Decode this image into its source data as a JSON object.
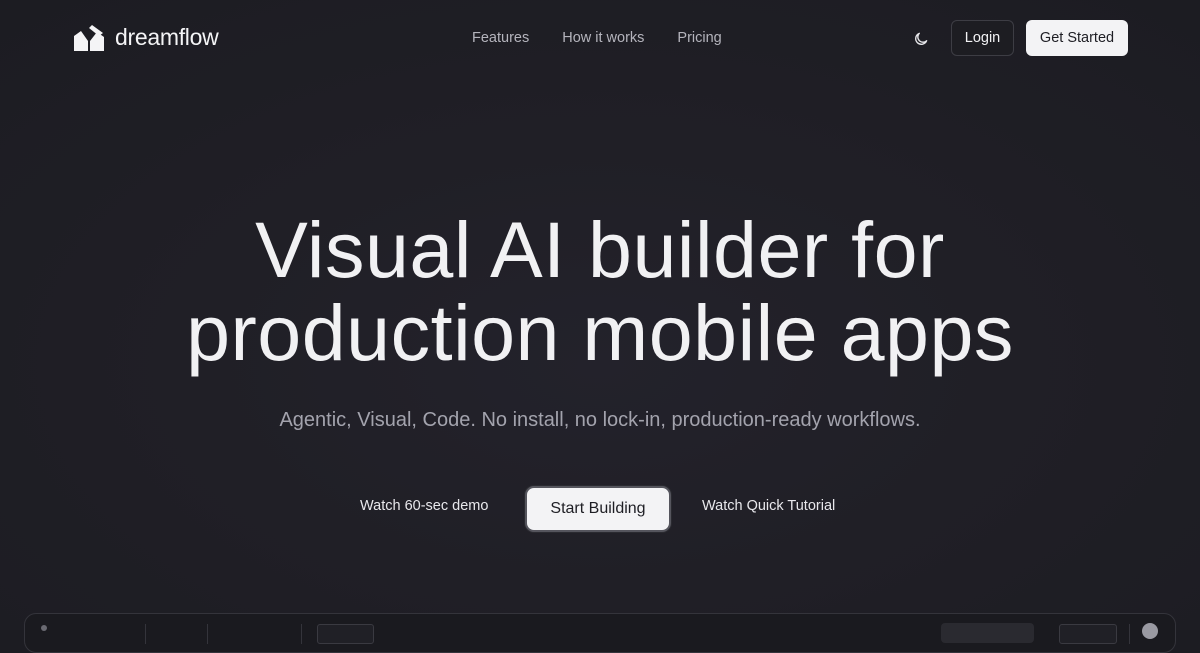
{
  "brand": {
    "name": "dreamflow",
    "logo_icon": "dreamflow-logo-icon"
  },
  "nav": {
    "items": [
      {
        "label": "Features"
      },
      {
        "label": "How it works"
      },
      {
        "label": "Pricing"
      }
    ]
  },
  "header": {
    "theme_toggle_icon": "moon-icon",
    "login_label": "Login",
    "get_started_label": "Get Started"
  },
  "hero": {
    "title_line1": "Visual AI builder for",
    "title_line2": "production mobile apps",
    "subtitle": "Agentic, Visual, Code. No install, no lock-in, production-ready workflows."
  },
  "cta": {
    "demo_label": "Watch 60-sec demo",
    "start_label": "Start Building",
    "tutorial_label": "Watch Quick Tutorial"
  },
  "colors": {
    "background": "#1f1f25",
    "text_primary": "#f1f1f3",
    "text_muted": "#a3a3ad",
    "button_light": "#f3f3f5",
    "button_dark": "#1d1d22"
  }
}
